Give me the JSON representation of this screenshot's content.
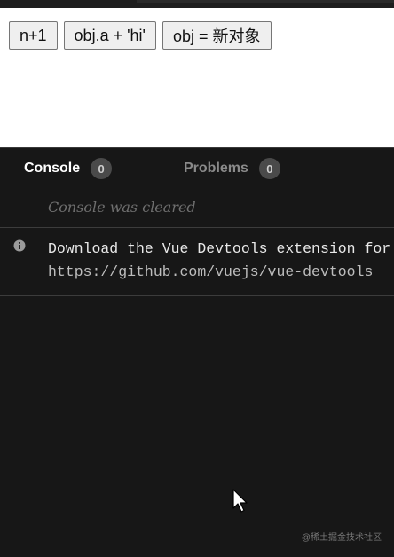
{
  "preview": {
    "buttons": [
      {
        "label": "n+1"
      },
      {
        "label": "obj.a + 'hi'"
      },
      {
        "label": "obj = 新对象"
      }
    ]
  },
  "console": {
    "tabs": [
      {
        "label": "Console",
        "count": "0",
        "active": true
      },
      {
        "label": "Problems",
        "count": "0",
        "active": false
      }
    ],
    "cleared_message": "Console was cleared",
    "entries": [
      {
        "icon": "info-icon",
        "line1": "Download the Vue Devtools extension for",
        "line2": "https://github.com/vuejs/vue-devtools"
      }
    ]
  },
  "watermark": "@稀土掘金技术社区",
  "colors": {
    "panel_bg": "#171717",
    "preview_bg": "#ffffff",
    "button_bg": "#efefef",
    "badge_bg": "#4a4a4a"
  }
}
